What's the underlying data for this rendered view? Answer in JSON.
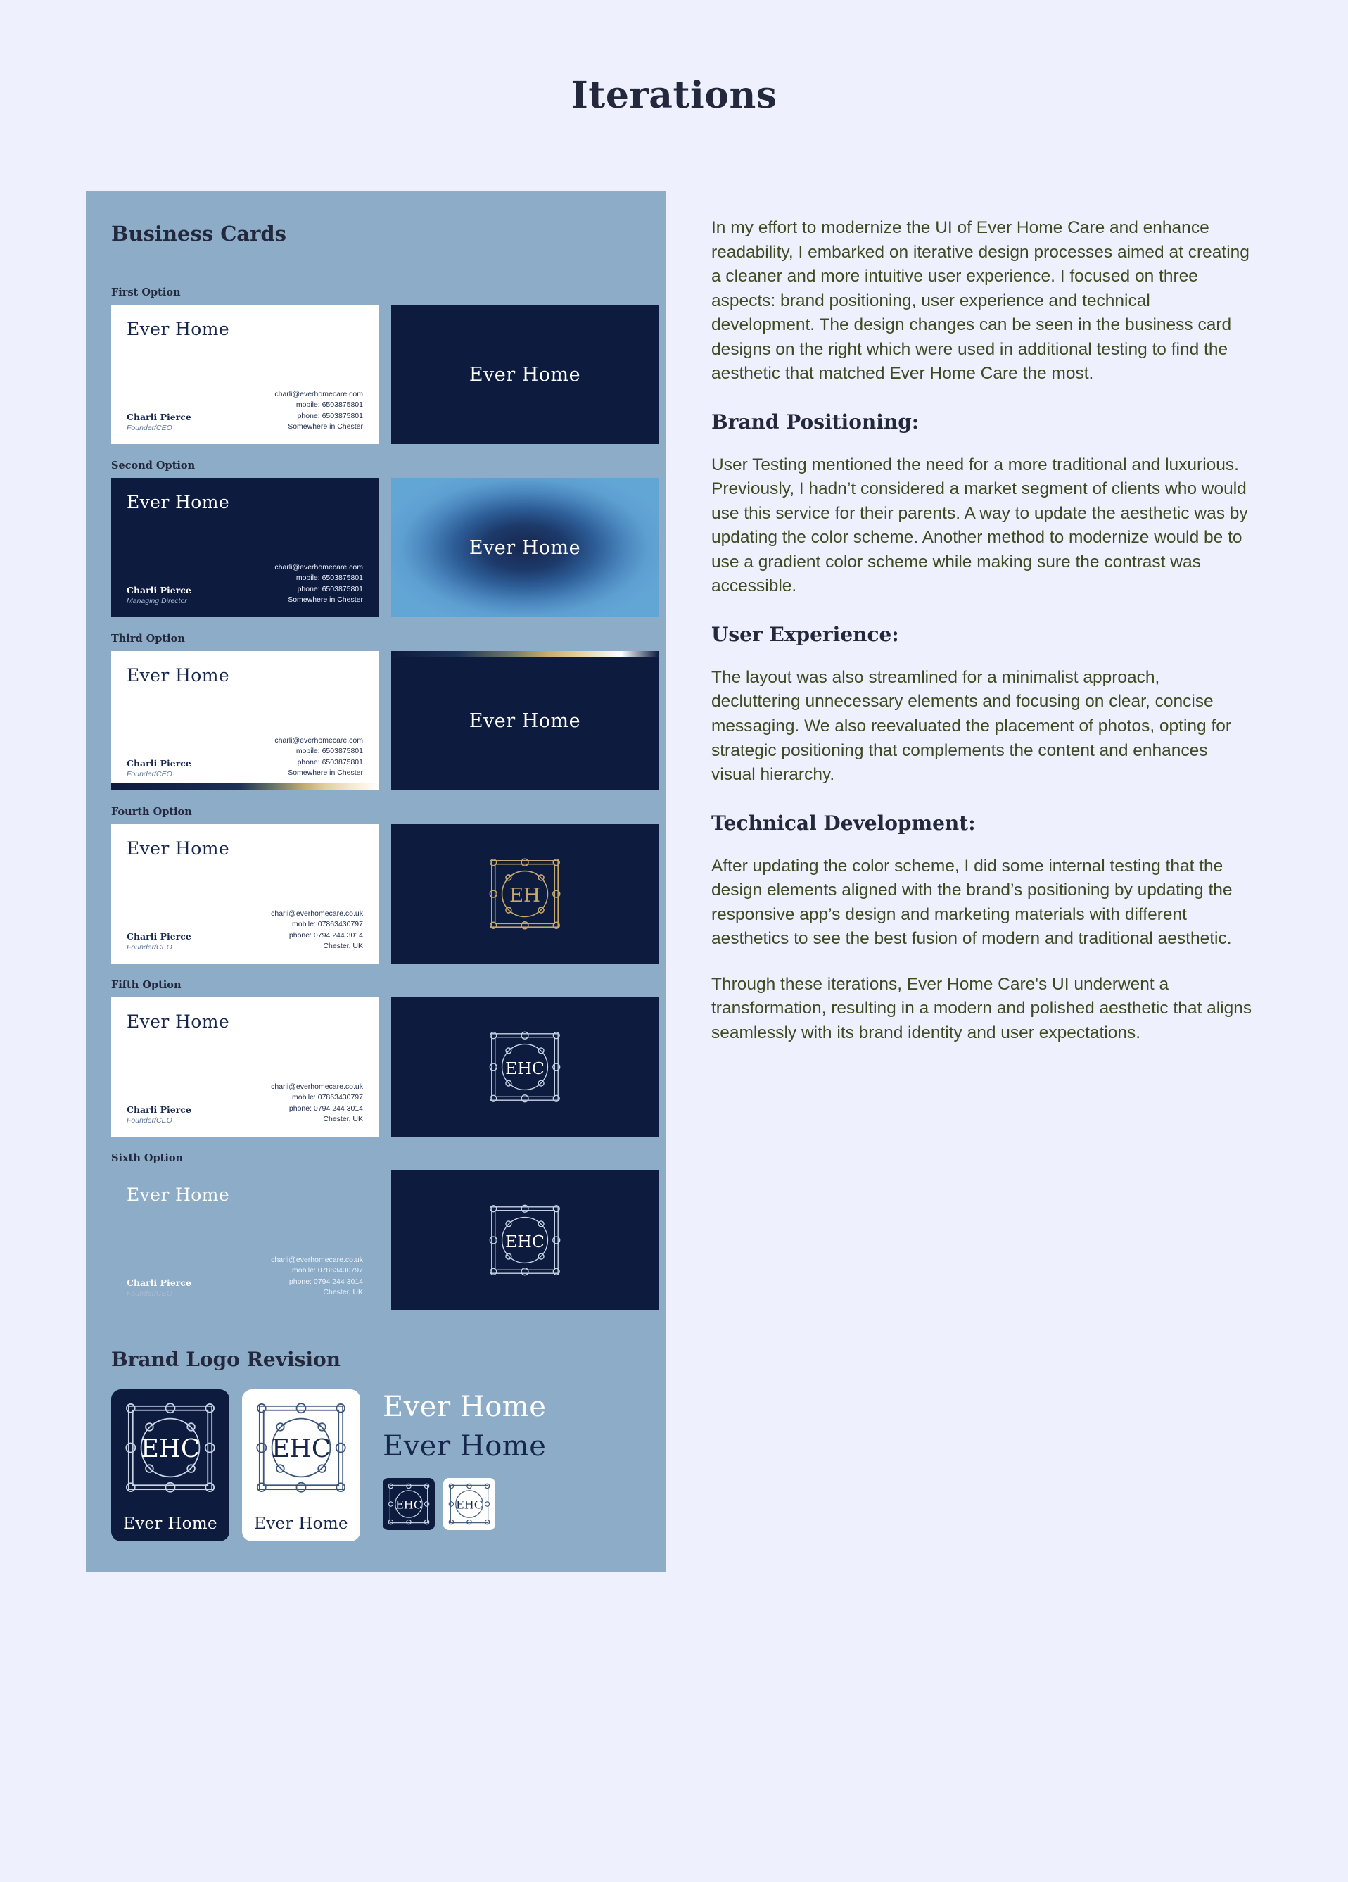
{
  "page": {
    "title": "Iterations"
  },
  "showcase": {
    "heading": "Business Cards",
    "logo_heading": "Brand Logo Revision",
    "options": [
      {
        "label": "First Option",
        "brand": "Ever Home",
        "name": "Charli Pierce",
        "role": "Founder/CEO",
        "email": "charli@everhomecare.com",
        "mobile": "mobile: 6503875801",
        "phone": "phone: 6503875801",
        "location": "Somewhere in Chester",
        "right_brand": "Ever Home"
      },
      {
        "label": "Second Option",
        "brand": "Ever Home",
        "name": "Charli Pierce",
        "role": "Managing Director",
        "email": "charli@everhomecare.com",
        "mobile": "mobile: 6503875801",
        "phone": "phone: 6503875801",
        "location": "Somewhere in Chester",
        "right_brand": "Ever Home"
      },
      {
        "label": "Third Option",
        "brand": "Ever Home",
        "name": "Charli Pierce",
        "role": "Founder/CEO",
        "email": "charli@everhomecare.com",
        "mobile": "mobile: 6503875801",
        "phone": "phone: 6503875801",
        "location": "Somewhere in Chester",
        "right_brand": "Ever Home"
      },
      {
        "label": "Fourth Option",
        "brand": "Ever Home",
        "name": "Charli Pierce",
        "role": "Founder/CEO",
        "email": "charli@everhomecare.co.uk",
        "mobile": "mobile: 07863430797",
        "phone": "phone: 0794 244 3014",
        "location": "Chester, UK",
        "monogram": "EH"
      },
      {
        "label": "Fifth Option",
        "brand": "Ever Home",
        "name": "Charli Pierce",
        "role": "Founder/CEO",
        "email": "charli@everhomecare.co.uk",
        "mobile": "mobile: 07863430797",
        "phone": "phone: 0794 244 3014",
        "location": "Chester, UK",
        "monogram": "EHC"
      },
      {
        "label": "Sixth Option",
        "brand": "Ever Home",
        "name": "Charli Pierce",
        "role": "Founder/CEO",
        "email": "charli@everhomecare.co.uk",
        "mobile": "mobile: 07863430797",
        "phone": "phone: 0794 244 3014",
        "location": "Chester, UK",
        "monogram": "EHC"
      }
    ],
    "logos": {
      "navy_card": {
        "monogram": "EHC",
        "name": "Ever Home"
      },
      "white_card": {
        "monogram": "EHC",
        "name": "Ever Home"
      },
      "wordmark_white": "Ever Home",
      "wordmark_navy": "Ever Home",
      "icon_navy": "EHC",
      "icon_white": "EHC"
    }
  },
  "notes": {
    "intro": "In my effort to modernize the UI of Ever Home Care and enhance readability, I embarked on iterative design processes aimed at creating a cleaner and more intuitive user experience. I focused on three aspects: brand positioning, user experience and technical development. The design changes can be seen in the business card designs on the right which were used in additional testing to find the aesthetic that matched Ever Home Care the most.",
    "brand_heading": "Brand Positioning:",
    "brand_body": "User Testing mentioned the need for a more traditional and luxurious. Previously, I hadn’t considered a market segment of clients who would use this service for their parents. A way to update the aesthetic was by updating the color scheme. Another method to modernize would be to use a gradient color scheme while making sure the contrast was accessible.",
    "ux_heading": "User Experience:",
    "ux_body": "The layout was also streamlined for a  minimalist approach, decluttering unnecessary elements and focusing on clear, concise messaging. We also reevaluated the placement of photos, opting for strategic positioning that complements the content and enhances visual hierarchy.",
    "tech_heading": "Technical Development:",
    "tech_body": "After updating the color scheme, I did some internal testing that the design elements aligned with the brand’s positioning by updating the responsive app’s design and marketing materials with different aesthetics to see the best fusion of modern and traditional aesthetic.",
    "closing": "Through these iterations, Ever Home Care's UI underwent a transformation, resulting in a modern and polished aesthetic that aligns seamlessly with its brand identity and user expectations."
  },
  "colors": {
    "page_bg": "#eef0fd",
    "panel_bg": "#8dacc8",
    "navy": "#0d1b3e",
    "gold": "#c6a96d",
    "body_text": "#3d4a22",
    "heading": "#23283c"
  }
}
